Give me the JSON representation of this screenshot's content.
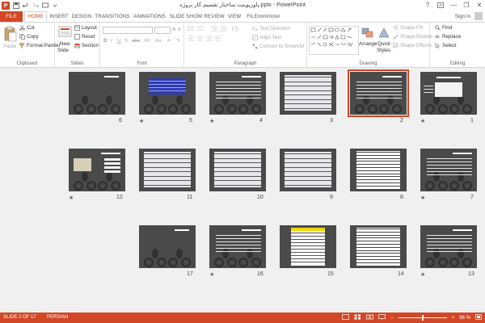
{
  "window": {
    "title": "پاورپوینت ساختار تقسیم کار پروژه.pptx - PowerPoint",
    "help": "?",
    "minimize": "—",
    "restore": "❐",
    "close": "✕"
  },
  "tabs": [
    "FILE",
    "HOME",
    "INSERT",
    "DESIGN",
    "TRANSITIONS",
    "ANIMATIONS",
    "SLIDE SHOW",
    "REVIEW",
    "VIEW",
    "FILEminimizer"
  ],
  "active_tab": "HOME",
  "account": {
    "signin": "Sign in"
  },
  "ribbon": {
    "clipboard": {
      "label": "Clipboard",
      "paste": "Paste",
      "cut": "Cut",
      "copy": "Copy",
      "format_painter": "Format Painter"
    },
    "slides": {
      "label": "Slides",
      "new_slide": "New",
      "new_slide2": "Slide",
      "layout": "Layout",
      "reset": "Reset",
      "section": "Section"
    },
    "font": {
      "label": "Font",
      "font_size": ""
    },
    "paragraph": {
      "label": "Paragraph",
      "text_direction": "Text Direction",
      "align_text": "Align Text",
      "convert_smartart": "Convert to SmartArt"
    },
    "drawing": {
      "label": "Drawing",
      "arrange": "Arrange",
      "quick_styles": "Quick",
      "quick_styles2": "Styles",
      "shape_fill": "Shape Fill",
      "shape_outline": "Shape Outline",
      "shape_effects": "Shape Effects"
    },
    "editing": {
      "label": "Editing",
      "find": "Find",
      "replace": "Replace",
      "select": "Select"
    }
  },
  "slides": [
    {
      "n": "1",
      "star": true
    },
    {
      "n": "2",
      "star": false
    },
    {
      "n": "3",
      "star": false
    },
    {
      "n": "4",
      "star": true
    },
    {
      "n": "5",
      "star": true
    },
    {
      "n": "6",
      "star": false
    },
    {
      "n": "7",
      "star": true
    },
    {
      "n": "8",
      "star": false
    },
    {
      "n": "9",
      "star": false
    },
    {
      "n": "10",
      "star": false
    },
    {
      "n": "11",
      "star": false
    },
    {
      "n": "12",
      "star": true
    },
    {
      "n": "13",
      "star": true
    },
    {
      "n": "14",
      "star": false
    },
    {
      "n": "15",
      "star": false
    },
    {
      "n": "16",
      "star": true
    },
    {
      "n": "17",
      "star": false
    }
  ],
  "selected_slide": "2",
  "statusbar": {
    "slide_info": "SLIDE 2 OF 17",
    "language": "PERSIAN",
    "zoom_minus": "−",
    "zoom_plus": "+",
    "zoom_level": "66 %",
    "zoom_fraction": 0.5
  },
  "colors": {
    "accent": "#d24726",
    "slide_bg": "#4a4a4a",
    "sorter_bg": "#f0f0f0"
  }
}
